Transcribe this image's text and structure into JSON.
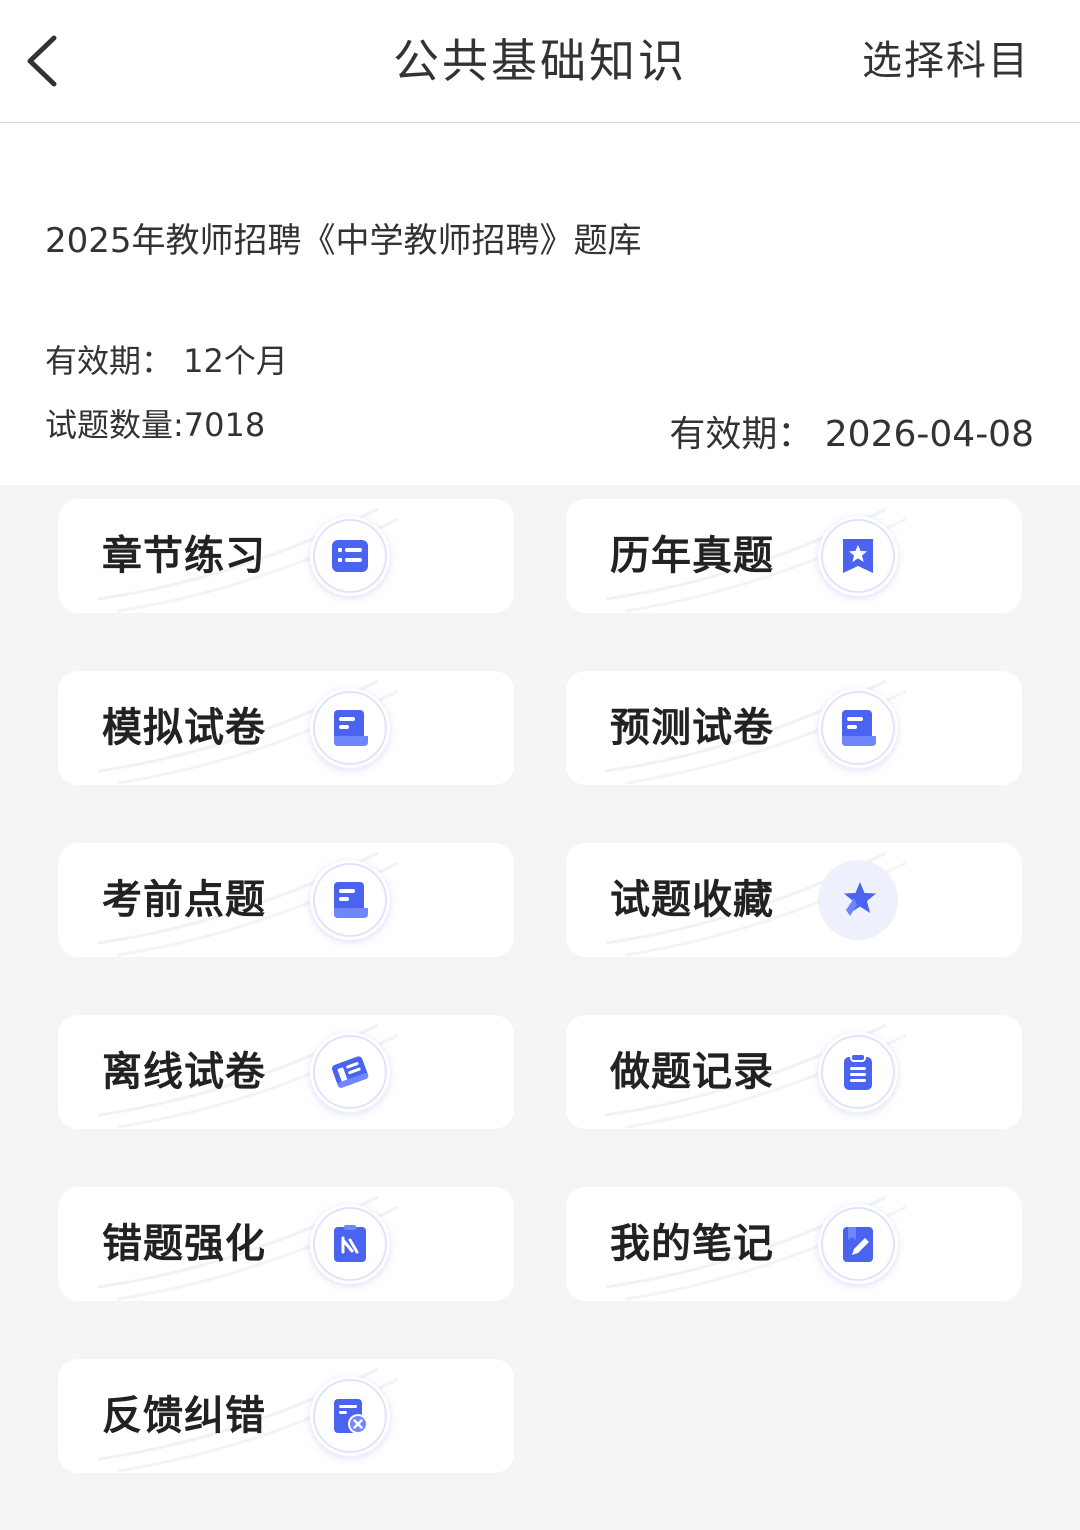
{
  "header": {
    "title": "公共基础知识",
    "right_action": "选择科目"
  },
  "info": {
    "bank_name": "2025年教师招聘《中学教师招聘》题库",
    "validity_period": "有效期：  12个月",
    "question_count": "试题数量:7018",
    "expire_date": "有效期：  2026-04-08"
  },
  "menu": {
    "items": [
      {
        "label": "章节练习",
        "icon": "list-icon"
      },
      {
        "label": "历年真题",
        "icon": "star-bookmark-icon"
      },
      {
        "label": "模拟试卷",
        "icon": "paper-icon"
      },
      {
        "label": "预测试卷",
        "icon": "paper-icon"
      },
      {
        "label": "考前点题",
        "icon": "paper-icon"
      },
      {
        "label": "试题收藏",
        "icon": "star-icon"
      },
      {
        "label": "离线试卷",
        "icon": "offline-paper-icon"
      },
      {
        "label": "做题记录",
        "icon": "clipboard-icon"
      },
      {
        "label": "错题强化",
        "icon": "wrong-question-icon"
      },
      {
        "label": "我的笔记",
        "icon": "note-pen-icon"
      },
      {
        "label": "反馈纠错",
        "icon": "feedback-icon"
      }
    ]
  },
  "colors": {
    "accent": "#4a63f0",
    "accent_light": "#6f86ff",
    "background": "#f5f5f7"
  }
}
